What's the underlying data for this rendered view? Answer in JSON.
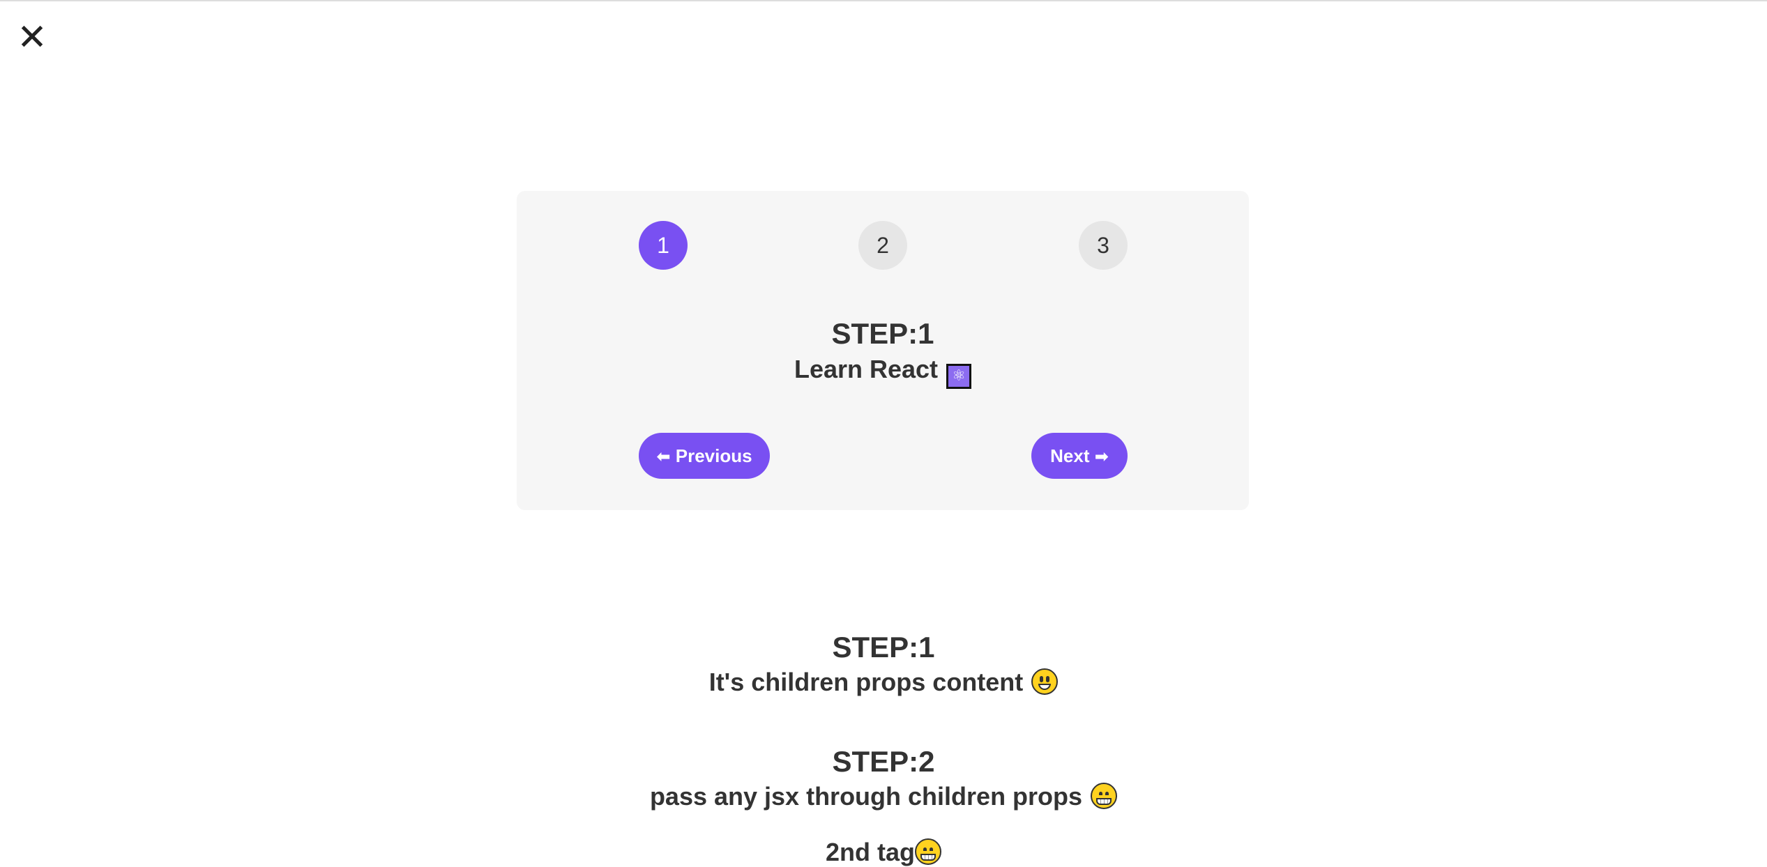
{
  "close_button": {
    "label": "✕"
  },
  "steps": {
    "items": [
      {
        "number": "1",
        "active": true
      },
      {
        "number": "2",
        "active": false
      },
      {
        "number": "3",
        "active": false
      }
    ],
    "current_title": "STEP:1",
    "current_text": "Learn React",
    "current_icon": "⚛",
    "previous_label": "Previous",
    "previous_arrow": "⬅",
    "next_label": "Next",
    "next_arrow": "➡",
    "accent_color": "#7950f2"
  },
  "children_content": [
    {
      "title": "STEP:1",
      "text": "It's children props content",
      "icon": "smiley-icon"
    },
    {
      "title": "STEP:2",
      "text": "pass any jsx through children props",
      "icon": "grin-icon"
    },
    {
      "text": "2nd tag",
      "icon": "grin-icon"
    }
  ]
}
